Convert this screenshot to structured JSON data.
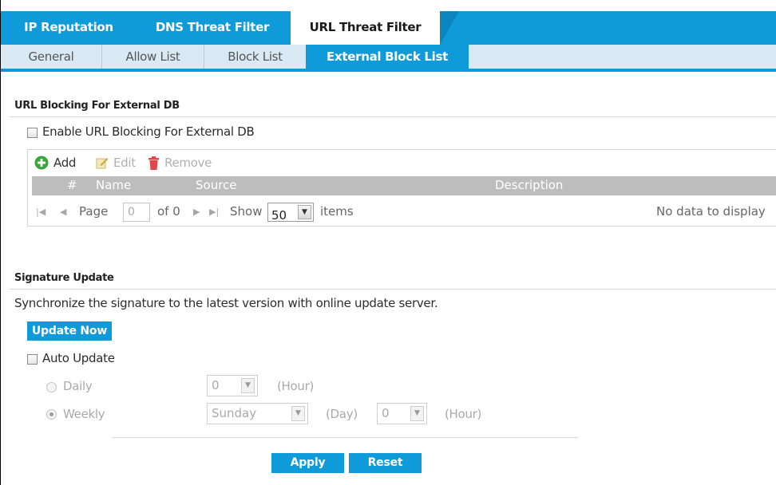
{
  "top_tabs": [
    {
      "label": "IP Reputation",
      "active": false
    },
    {
      "label": "DNS Threat Filter",
      "active": false
    },
    {
      "label": "URL Threat Filter",
      "active": true
    }
  ],
  "sub_tabs": [
    {
      "label": "General",
      "active": false
    },
    {
      "label": "Allow List",
      "active": false
    },
    {
      "label": "Block List",
      "active": false
    },
    {
      "label": "External Block List",
      "active": true
    }
  ],
  "url_blocking": {
    "section_title": "URL Blocking For External DB",
    "enable_label": "Enable URL Blocking For External DB",
    "enable_checked": false,
    "toolbar": {
      "add": "Add",
      "edit": "Edit",
      "remove": "Remove"
    },
    "columns": [
      "#",
      "Name",
      "Source",
      "Description"
    ],
    "pager": {
      "page_label": "Page",
      "page_value": "0",
      "of_label": "of 0",
      "show_label": "Show",
      "show_value": "50",
      "items_label": "items",
      "empty_text": "No data to display"
    }
  },
  "signature_update": {
    "section_title": "Signature Update",
    "description": "Synchronize the signature to the latest version with online update server.",
    "update_button": "Update Now",
    "auto_update_label": "Auto Update",
    "auto_update_checked": false,
    "daily_label": "Daily",
    "daily_hour": "0",
    "hour_label": "(Hour)",
    "weekly_label": "Weekly",
    "weekly_day": "Sunday",
    "day_label": "(Day)",
    "weekly_hour": "0",
    "weekly_hour_label": "(Hour)"
  },
  "actions": {
    "apply": "Apply",
    "reset": "Reset"
  },
  "colors": {
    "accent": "#0f9bd9",
    "subbar": "#d9eaf4",
    "add_green": "#3aa53a",
    "remove_red": "#e1474a"
  }
}
